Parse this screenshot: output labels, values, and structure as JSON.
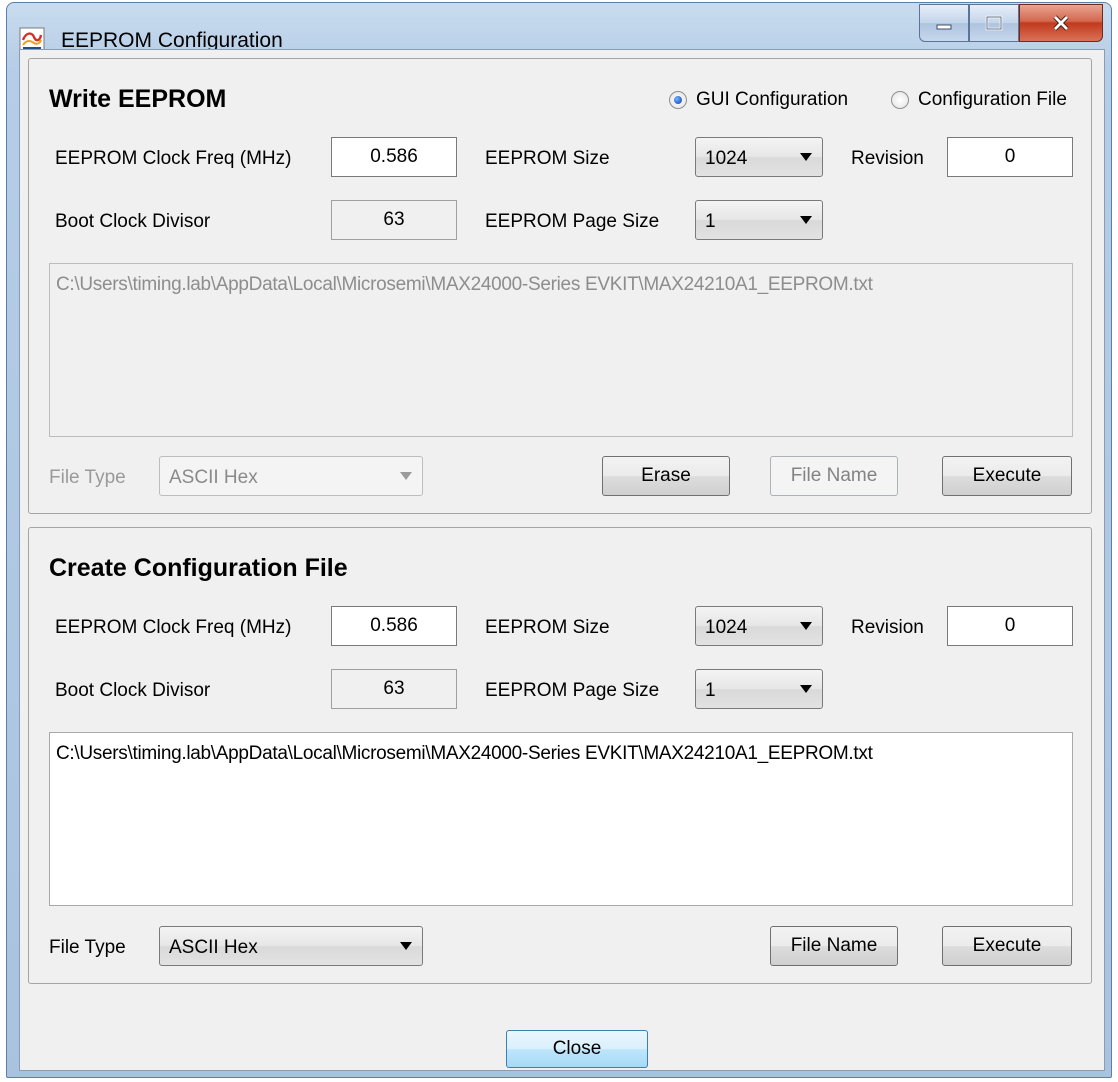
{
  "window": {
    "title": "EEPROM Configuration"
  },
  "icons": {
    "app": "app-icon",
    "minimize": "minimize-icon",
    "maximize": "maximize-icon",
    "close": "close-icon",
    "dropdown": "chevron-down-icon"
  },
  "write": {
    "title": "Write EEPROM",
    "radio_gui": "GUI Configuration",
    "radio_file": "Configuration File",
    "radio_selected": "GUI Configuration",
    "clock_label": "EEPROM Clock Freq (MHz)",
    "clock_value": "0.586",
    "size_label": "EEPROM Size",
    "size_value": "1024",
    "revision_label": "Revision",
    "revision_value": "0",
    "boot_label": "Boot Clock Divisor",
    "boot_value": "63",
    "page_label": "EEPROM Page Size",
    "page_value": "1",
    "path": "C:\\Users\\timing.lab\\AppData\\Local\\Microsemi\\MAX24000-Series EVKIT\\MAX24210A1_EEPROM.txt",
    "filetype_label": "File Type",
    "filetype_value": "ASCII Hex",
    "erase_button": "Erase",
    "filename_button": "File Name",
    "execute_button": "Execute"
  },
  "create": {
    "title": "Create Configuration File",
    "clock_label": "EEPROM Clock Freq (MHz)",
    "clock_value": "0.586",
    "size_label": "EEPROM Size",
    "size_value": "1024",
    "revision_label": "Revision",
    "revision_value": "0",
    "boot_label": "Boot Clock Divisor",
    "boot_value": "63",
    "page_label": "EEPROM Page Size",
    "page_value": "1",
    "path": "C:\\Users\\timing.lab\\AppData\\Local\\Microsemi\\MAX24000-Series EVKIT\\MAX24210A1_EEPROM.txt",
    "filetype_label": "File Type",
    "filetype_value": "ASCII Hex",
    "filename_button": "File Name",
    "execute_button": "Execute"
  },
  "footer": {
    "close_button": "Close"
  }
}
